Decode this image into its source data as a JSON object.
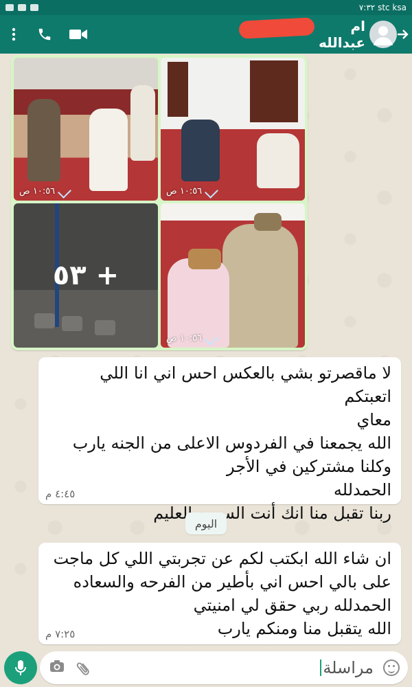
{
  "status_bar": {
    "left_icons": "signal-wifi-bluetooth",
    "right_text": "٧:٣٢ stc ksa"
  },
  "header": {
    "contact_name": "ام عبدالله"
  },
  "media_album": {
    "tiles": [
      {
        "time": "١٠:٥٦ ص"
      },
      {
        "time": "١٠:٥٦ ص"
      },
      {
        "more_label": "٥٣ +"
      },
      {
        "time": "١٠:٥٦ ص"
      }
    ]
  },
  "messages": [
    {
      "lines": [
        "لا ماقصرتو بشي بالعكس احس اني انا اللي اتعبتكم",
        "معاي",
        "الله يجمعنا في الفردوس الاعلى من الجنه يارب",
        "وكلنا مشتركين في الأجر",
        "الحمدلله",
        "ربنا تقبل منا انك أنت السميع العليم"
      ],
      "time": "٤:٤٥ م"
    },
    {
      "lines": [
        "ان شاء الله ابكتب لكم عن تجربتي اللي كل ماجت",
        "على بالي احس اني بأطير من الفرحه والسعاده",
        "الحمدلله ربي حقق لي امنيتي",
        "الله يتقبل منا ومنكم يارب"
      ],
      "time": "٧:٢٥ م"
    }
  ],
  "date_chip": "اليوم",
  "composer": {
    "placeholder": "مراسلة"
  },
  "colors": {
    "header": "#0e7a6c",
    "accent": "#1ba07b",
    "outgoing": "#d7f5c6",
    "incoming": "#ffffff"
  }
}
